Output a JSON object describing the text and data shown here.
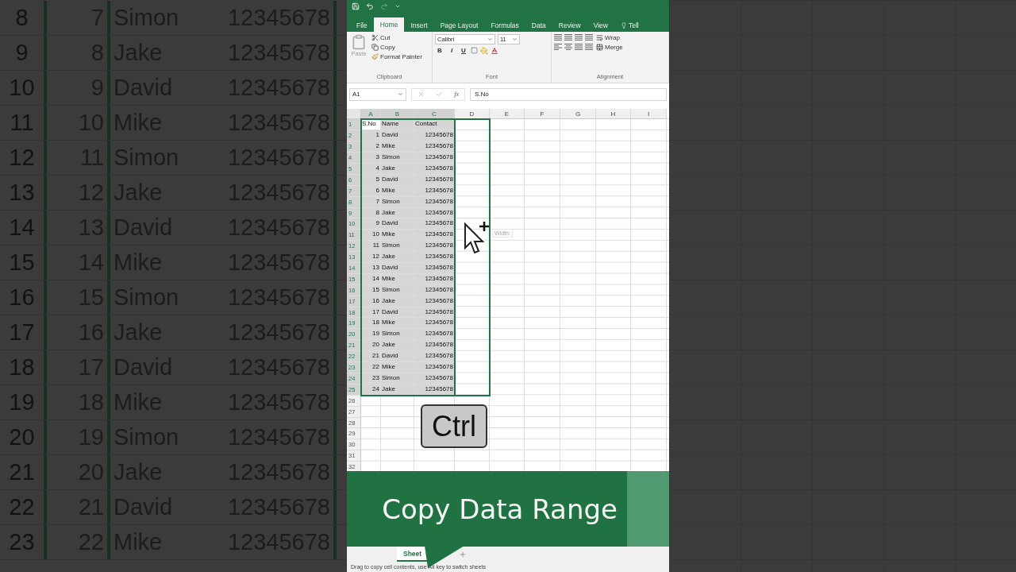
{
  "backdrop_left": {
    "rows": [
      {
        "row_number": "8",
        "s_no": "7",
        "name": "Simon",
        "contact": "12345678"
      },
      {
        "row_number": "9",
        "s_no": "8",
        "name": "Jake",
        "contact": "12345678"
      },
      {
        "row_number": "10",
        "s_no": "9",
        "name": "David",
        "contact": "12345678"
      },
      {
        "row_number": "11",
        "s_no": "10",
        "name": "Mike",
        "contact": "12345678"
      },
      {
        "row_number": "12",
        "s_no": "11",
        "name": "Simon",
        "contact": "12345678"
      },
      {
        "row_number": "13",
        "s_no": "12",
        "name": "Jake",
        "contact": "12345678"
      },
      {
        "row_number": "14",
        "s_no": "13",
        "name": "David",
        "contact": "12345678"
      },
      {
        "row_number": "15",
        "s_no": "14",
        "name": "Mike",
        "contact": "12345678"
      },
      {
        "row_number": "16",
        "s_no": "15",
        "name": "Simon",
        "contact": "12345678"
      },
      {
        "row_number": "17",
        "s_no": "16",
        "name": "Jake",
        "contact": "12345678"
      },
      {
        "row_number": "18",
        "s_no": "17",
        "name": "David",
        "contact": "12345678"
      },
      {
        "row_number": "19",
        "s_no": "18",
        "name": "Mike",
        "contact": "12345678"
      },
      {
        "row_number": "20",
        "s_no": "19",
        "name": "Simon",
        "contact": "12345678"
      },
      {
        "row_number": "21",
        "s_no": "20",
        "name": "Jake",
        "contact": "12345678"
      },
      {
        "row_number": "22",
        "s_no": "21",
        "name": "David",
        "contact": "12345678"
      },
      {
        "row_number": "23",
        "s_no": "22",
        "name": "Mike",
        "contact": "12345678"
      }
    ]
  },
  "ribbon_tabs": [
    {
      "label": "File",
      "selected": false
    },
    {
      "label": "Home",
      "selected": true
    },
    {
      "label": "Insert",
      "selected": false
    },
    {
      "label": "Page Layout",
      "selected": false
    },
    {
      "label": "Formulas",
      "selected": false
    },
    {
      "label": "Data",
      "selected": false
    },
    {
      "label": "Review",
      "selected": false
    },
    {
      "label": "View",
      "selected": false
    },
    {
      "label": "Tell",
      "selected": false
    }
  ],
  "clipboard": {
    "paste": "Paste",
    "cut": "Cut",
    "copy": "Copy",
    "format_painter": "Format Painter",
    "group_label": "Clipboard"
  },
  "font": {
    "font_name": "Calibri",
    "font_size": "11",
    "bold": "B",
    "italic": "I",
    "underline": "U",
    "group_label": "Font"
  },
  "alignment": {
    "wrap": "Wrap",
    "merge": "Merge",
    "group_label": "Alignment"
  },
  "name_box": "A1",
  "function_label": "fx",
  "formula": "S.No",
  "columns": [
    {
      "letter": "A",
      "selected": true
    },
    {
      "letter": "B",
      "selected": true
    },
    {
      "letter": "C",
      "selected": true
    },
    {
      "letter": "D",
      "selected": false,
      "drag_preview": true
    },
    {
      "letter": "E",
      "selected": false
    },
    {
      "letter": "F",
      "selected": false
    },
    {
      "letter": "G",
      "selected": false
    },
    {
      "letter": "H",
      "selected": false
    },
    {
      "letter": "I",
      "selected": false
    }
  ],
  "rows": [
    {
      "number": "1",
      "selected": true,
      "cells": [
        {
          "text": "S.No",
          "active": true
        },
        "Name",
        "Contact"
      ]
    },
    {
      "number": "2",
      "selected": true,
      "cells": [
        "1",
        "David",
        "12345678"
      ]
    },
    {
      "number": "3",
      "selected": true,
      "cells": [
        "2",
        "Mike",
        "12345678"
      ]
    },
    {
      "number": "4",
      "selected": true,
      "cells": [
        "3",
        "Simon",
        "12345678"
      ]
    },
    {
      "number": "5",
      "selected": true,
      "cells": [
        "4",
        "Jake",
        "12345678"
      ]
    },
    {
      "number": "6",
      "selected": true,
      "cells": [
        "5",
        "David",
        "12345678"
      ]
    },
    {
      "number": "7",
      "selected": true,
      "cells": [
        "6",
        "Mike",
        "12345678"
      ]
    },
    {
      "number": "8",
      "selected": true,
      "cells": [
        "7",
        "Simon",
        "12345678"
      ]
    },
    {
      "number": "9",
      "selected": true,
      "cells": [
        "8",
        "Jake",
        "12345678"
      ]
    },
    {
      "number": "10",
      "selected": true,
      "cells": [
        "9",
        "David",
        "12345678"
      ]
    },
    {
      "number": "11",
      "selected": true,
      "cells": [
        "10",
        "Mike",
        "12345678"
      ]
    },
    {
      "number": "12",
      "selected": true,
      "cells": [
        "11",
        "Simon",
        "12345678"
      ]
    },
    {
      "number": "13",
      "selected": true,
      "cells": [
        "12",
        "Jake",
        "12345678"
      ]
    },
    {
      "number": "14",
      "selected": true,
      "cells": [
        "13",
        "David",
        "12345678"
      ]
    },
    {
      "number": "15",
      "selected": true,
      "cells": [
        "14",
        "Mike",
        "12345678"
      ]
    },
    {
      "number": "16",
      "selected": true,
      "cells": [
        "15",
        "Simon",
        "12345678"
      ]
    },
    {
      "number": "17",
      "selected": true,
      "cells": [
        "16",
        "Jake",
        "12345678"
      ]
    },
    {
      "number": "18",
      "selected": true,
      "cells": [
        "17",
        "David",
        "12345678"
      ]
    },
    {
      "number": "19",
      "selected": true,
      "cells": [
        "18",
        "Mike",
        "12345678"
      ]
    },
    {
      "number": "20",
      "selected": true,
      "cells": [
        "19",
        "Simon",
        "12345678"
      ]
    },
    {
      "number": "21",
      "selected": true,
      "cells": [
        "20",
        "Jake",
        "12345678"
      ]
    },
    {
      "number": "22",
      "selected": true,
      "cells": [
        "21",
        "David",
        "12345678"
      ]
    },
    {
      "number": "23",
      "selected": true,
      "cells": [
        "22",
        "Mike",
        "12345678"
      ]
    },
    {
      "number": "24",
      "selected": true,
      "cells": [
        "23",
        "Simon",
        "12345678"
      ]
    },
    {
      "number": "25",
      "selected": true,
      "cells": [
        "24",
        "Jake",
        "12345678"
      ]
    },
    {
      "number": "26",
      "selected": false
    },
    {
      "number": "27",
      "selected": false
    },
    {
      "number": "28",
      "selected": false
    },
    {
      "number": "29",
      "selected": false
    },
    {
      "number": "30",
      "selected": false
    },
    {
      "number": "31",
      "selected": false
    },
    {
      "number": "32",
      "selected": false
    }
  ],
  "tooltip": "Width:",
  "key_overlay": "Ctrl",
  "banner": "Copy Data Range",
  "sheet_tab": {
    "label": "Sheet",
    "selected": true
  },
  "status_bar": "Drag to copy cell contents, use Alt key to switch sheets"
}
